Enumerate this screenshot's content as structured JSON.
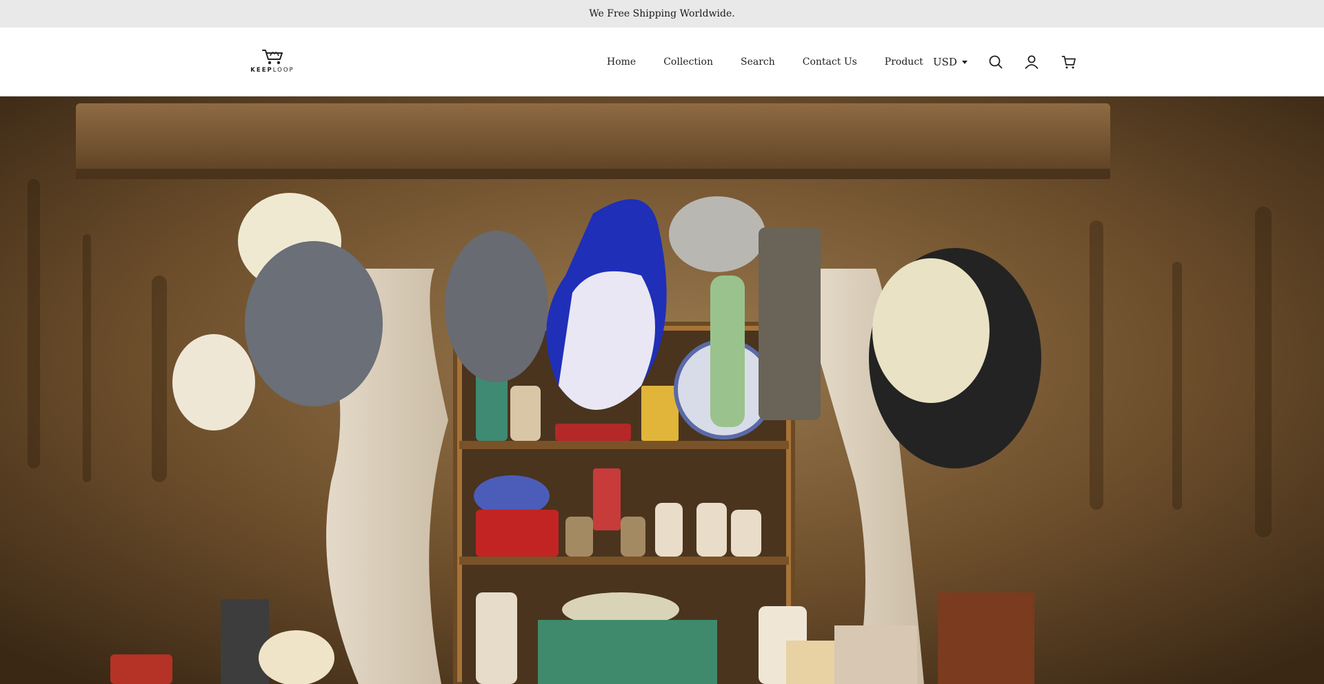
{
  "announcement": {
    "text": "We Free Shipping Worldwide."
  },
  "brand": {
    "logo_text_bold": "KEEP",
    "logo_text_light": "LOOP"
  },
  "nav": {
    "items": [
      {
        "label": "Home"
      },
      {
        "label": "Collection"
      },
      {
        "label": "Search"
      },
      {
        "label": "Contact Us"
      },
      {
        "label": "Product"
      }
    ]
  },
  "currency": {
    "selected": "USD"
  },
  "icons": {
    "search": "search-icon",
    "account": "user-icon",
    "cart": "cart-icon"
  },
  "colors": {
    "announcement_bg": "#e9e9e9",
    "header_bg": "#ffffff",
    "text": "#1f1f1f"
  }
}
